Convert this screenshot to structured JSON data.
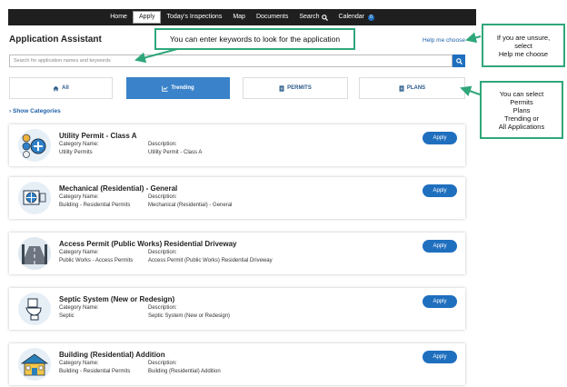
{
  "nav": {
    "items": [
      {
        "label": "Home"
      },
      {
        "label": "Apply",
        "active": true
      },
      {
        "label": "Today's Inspections"
      },
      {
        "label": "Map"
      },
      {
        "label": "Documents"
      },
      {
        "label": "Search",
        "icon": "search-icon"
      },
      {
        "label": "Calendar",
        "badge": "0"
      }
    ]
  },
  "page": {
    "title": "Application Assistant",
    "help_link": "Help me choose"
  },
  "search": {
    "placeholder": "Search for application names and keywords",
    "button_icon": "search-icon"
  },
  "tabs": [
    {
      "label": "All",
      "icon": "home-icon"
    },
    {
      "label": "Trending",
      "icon": "chart-icon",
      "active": true
    },
    {
      "label": "PERMITS",
      "icon": "document-icon"
    },
    {
      "label": "PLANS",
      "icon": "document-icon"
    }
  ],
  "show_categories": "Show Categories",
  "category_label": "Category Name:",
  "description_label": "Description:",
  "apply_label": "Apply",
  "applications": [
    {
      "name": "Utility Permit - Class A",
      "category": "Utility Permits",
      "description": "Utility Permit - Class A",
      "icon": "utility-icon"
    },
    {
      "name": "Mechanical (Residential) - General",
      "category": "Building - Residential Permits",
      "description": "Mechanical (Residential) - General",
      "icon": "hvac-icon"
    },
    {
      "name": "Access Permit (Public Works) Residential Driveway",
      "category": "Public Works - Access Permits",
      "description": "Access Permit (Public Works) Residential Driveway",
      "icon": "road-icon"
    },
    {
      "name": "Septic System (New or Redesign)",
      "category": "Septic",
      "description": "Septic System (New or Redesign)",
      "icon": "toilet-icon"
    },
    {
      "name": "Building (Residential) Addition",
      "category": "Building - Residential Permits",
      "description": "Building (Residential) Addition",
      "icon": "house-icon"
    }
  ],
  "callouts": {
    "keywords": "You can enter keywords to look for the application",
    "unsure": [
      "If you are unsure,",
      "select",
      "Help me choose"
    ],
    "select": [
      "You can select",
      "Permits",
      "Plans",
      "Trending or",
      "All Applications"
    ]
  },
  "colors": {
    "accent": "#1f6fbf",
    "callout_border": "#2fa77a",
    "nav_bg": "#1f1f1f"
  }
}
